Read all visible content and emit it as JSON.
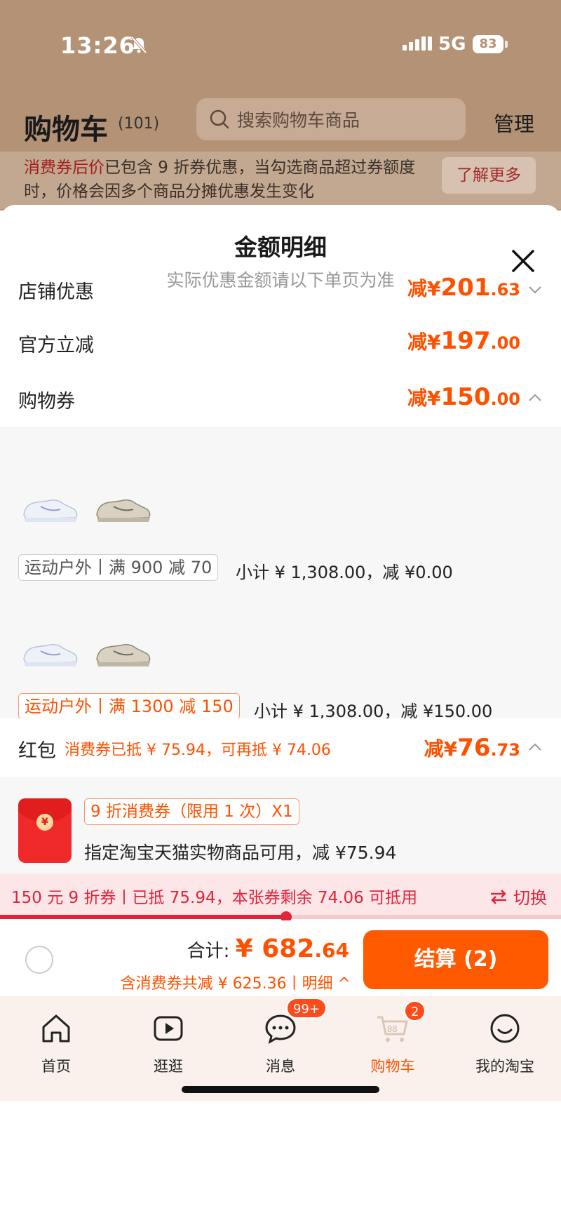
{
  "status_bar": {
    "time": "13:26",
    "network": "5G",
    "battery": "83"
  },
  "cart_header": {
    "title": "购物车",
    "count": "(101)",
    "search_placeholder": "搜索购物车商品",
    "manage": "管理"
  },
  "notice": {
    "highlight": "消费券后价",
    "text": "已包含 9 折券优惠，当勾选商品超过券额度时，价格会因多个商品分摊优惠发生变化",
    "button": "了解更多"
  },
  "sheet": {
    "title": "金额明细",
    "subtitle": "实际优惠金额请以下单页为准",
    "rows": [
      {
        "label": "店铺优惠",
        "prefix": "减",
        "currency": "¥",
        "int": "201",
        "dec": ".63",
        "chevron": "down"
      },
      {
        "label": "官方立减",
        "prefix": "减",
        "currency": "¥",
        "int": "197",
        "dec": ".00"
      },
      {
        "label": "购物券",
        "prefix": "减",
        "currency": "¥",
        "int": "150",
        "dec": ".00",
        "chevron": "up"
      }
    ],
    "coupon_groups": [
      {
        "tag": "运动户外丨满 900 减 70",
        "subtotal": "小计 ¥ 1,308.00，减 ¥0.00",
        "active": false
      },
      {
        "tag": "运动户外丨满 1300 减 150",
        "subtotal": "小计 ¥ 1,308.00，减 ¥150.00",
        "active": true
      }
    ],
    "red_packet": {
      "label": "红包",
      "note": "消费券已抵 ¥ 75.94，可再抵 ¥ 74.06",
      "prefix": "减",
      "currency": "¥",
      "int": "76",
      "dec": ".73"
    },
    "voucher": {
      "tag": "9 折消费券（限用 1 次）X1",
      "desc": "指定淘宝天猫实物商品可用，减 ¥75.94",
      "icon_symbol": "¥"
    },
    "progress": {
      "text": "150 元 9 折券丨已抵 75.94，本张券剩余 74.06 可抵用",
      "switch": "切换",
      "fraction": 0.51
    }
  },
  "checkout": {
    "total_label": "合计: ",
    "currency": "¥ ",
    "int": "682",
    "dec": ".64",
    "discount": "含消费券共减 ¥ 625.36丨明细 ^",
    "button": "结算 (2)"
  },
  "tabbar": {
    "tabs": [
      {
        "label": "首页",
        "icon": "home-icon"
      },
      {
        "label": "逛逛",
        "icon": "video-play-icon"
      },
      {
        "label": "消息",
        "icon": "message-icon",
        "badge": "99+"
      },
      {
        "label": "购物车",
        "icon": "cart-icon",
        "badge": "2",
        "icon_text": "88",
        "active": true
      },
      {
        "label": "我的淘宝",
        "icon": "profile-smile-icon"
      }
    ]
  },
  "colors": {
    "accent": "#ff5000",
    "checkout_button": "#ff5a00",
    "progress_red": "#e2233a",
    "overlay_brown": "#b39275"
  }
}
